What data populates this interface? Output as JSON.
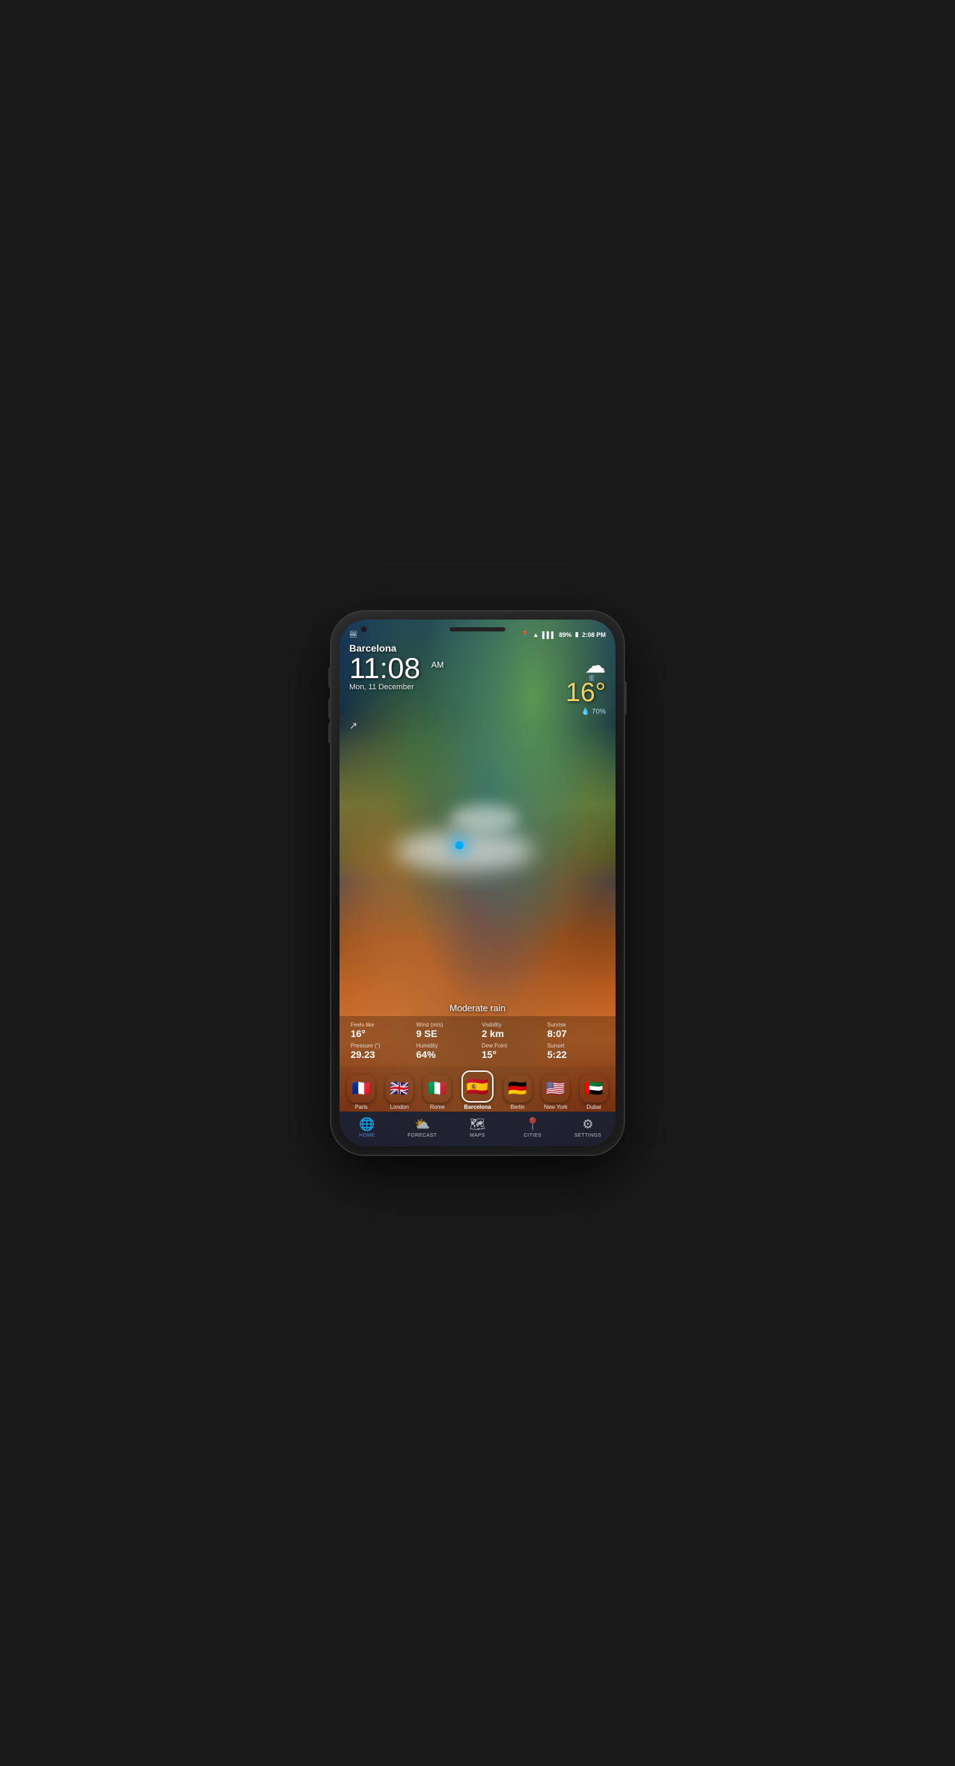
{
  "phone": {
    "screen": {
      "statusBar": {
        "leftIcon": "🖼",
        "locationIcon": "📍",
        "wifiIcon": "WiFi",
        "signalIcon": "▌▌▌",
        "batteryPercent": "89%",
        "batteryIcon": "🔋",
        "time": "2:08 PM"
      },
      "weather": {
        "cityName": "Barcelona",
        "time": "11",
        "timeMinutes": "08",
        "timeAmPm": "AM",
        "date": "Mon, 11 December",
        "temperature": "16°",
        "humidity": "💧 70%",
        "condition": "Moderate rain",
        "feelsLikeLabel": "Feels like",
        "feelsLikeValue": "16°",
        "windLabel": "Wind (m/s)",
        "windValue": "9 SE",
        "visibilityLabel": "Visibility",
        "visibilityValue": "2 km",
        "sunriseLabel": "Sunrise",
        "sunriseValue": "8:07",
        "pressureLabel": "Pressure (\")",
        "pressureValue": "29.23",
        "humidityLabel": "Humidity",
        "humidityValue": "64%",
        "dewPointLabel": "Dew Point",
        "dewPointValue": "15°",
        "sunsetLabel": "Sunset",
        "sunsetValue": "5:22"
      },
      "cities": [
        {
          "label": "Paris",
          "flag": "🇫🇷",
          "active": false
        },
        {
          "label": "London",
          "flag": "🇬🇧",
          "active": false
        },
        {
          "label": "Rome",
          "flag": "🇮🇹",
          "active": false
        },
        {
          "label": "Barcelona",
          "flag": "🇪🇸",
          "active": true
        },
        {
          "label": "Berlin",
          "flag": "🇩🇪",
          "active": false
        },
        {
          "label": "New York",
          "flag": "🇺🇸",
          "active": false
        },
        {
          "label": "Dubai",
          "flag": "🇦🇪",
          "active": false
        }
      ],
      "nav": [
        {
          "label": "HOME",
          "icon": "🌐",
          "active": true
        },
        {
          "label": "FORECAST",
          "icon": "⛅",
          "active": false
        },
        {
          "label": "MAPS",
          "icon": "🗺",
          "active": false
        },
        {
          "label": "CITIES",
          "icon": "📍",
          "active": false
        },
        {
          "label": "SETTINGS",
          "icon": "⚙",
          "active": false
        }
      ]
    }
  }
}
